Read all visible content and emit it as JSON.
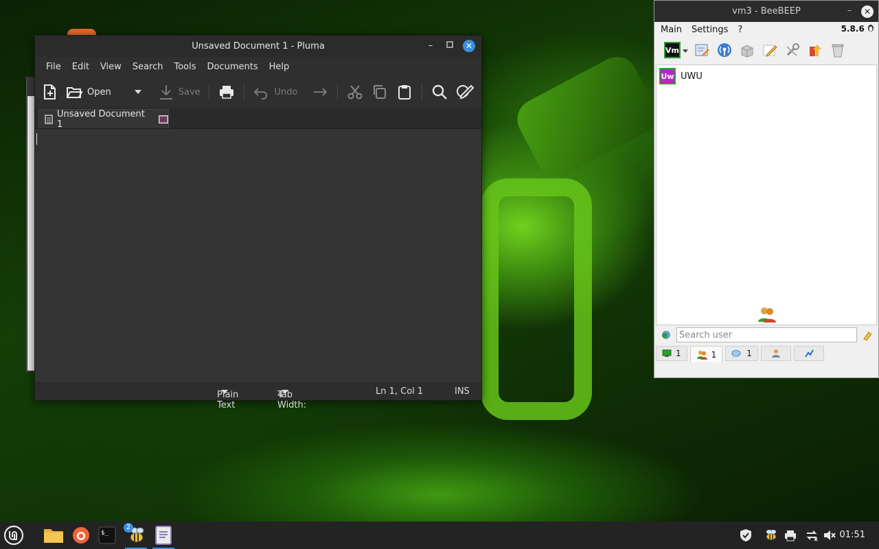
{
  "pluma": {
    "title": "Unsaved Document 1 - Pluma",
    "menu": [
      "File",
      "Edit",
      "View",
      "Search",
      "Tools",
      "Documents",
      "Help"
    ],
    "toolbar": {
      "open_label": "Open",
      "save_label": "Save",
      "undo_label": "Undo"
    },
    "tab_label": "Unsaved Document 1",
    "status": {
      "language": "Plain Text",
      "tab_width": "Tab Width:",
      "tab_width_value": "4",
      "position": "Ln 1, Col 1",
      "mode": "INS"
    }
  },
  "beebeep": {
    "title": "vm3 - BeeBEEP",
    "menu": [
      "Main",
      "Settings",
      "?"
    ],
    "version": "5.8.6",
    "profile_badge": "Vm",
    "users": [
      {
        "initials": "Uw",
        "name": "UWU"
      }
    ],
    "search_placeholder": "Search user",
    "tabs": [
      {
        "icon": "monitor-icon",
        "count": "1"
      },
      {
        "icon": "users-icon",
        "count": "1"
      },
      {
        "icon": "chat-icon",
        "count": "1"
      },
      {
        "icon": "groups-icon",
        "count": ""
      },
      {
        "icon": "link-icon",
        "count": ""
      }
    ]
  },
  "taskbar": {
    "clock": "01:51",
    "beebeep_badge": "2"
  },
  "colors": {
    "accent": "#3b8fdc",
    "avatar": "#b526c9",
    "online": "#2aa32a"
  }
}
